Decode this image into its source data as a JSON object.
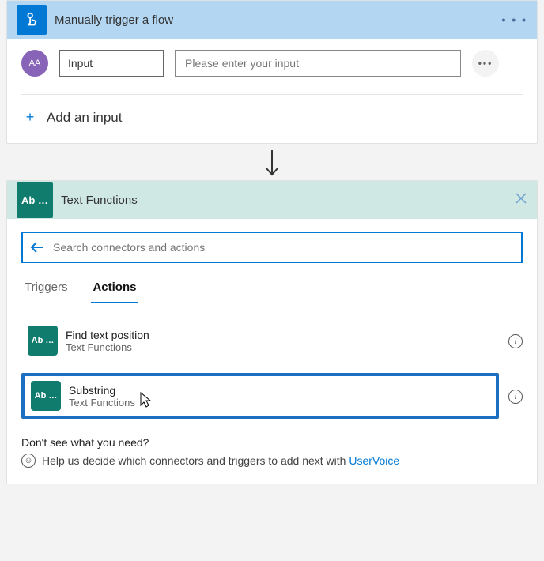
{
  "trigger": {
    "title": "Manually trigger a flow",
    "icon_name": "tap-icon",
    "more_label": "…",
    "input_row": {
      "badge": "AA",
      "name_value": "Input",
      "value_placeholder": "Please enter your input",
      "row_more": "…"
    },
    "add_input_label": "Add an input"
  },
  "action_picker": {
    "title": "Text Functions",
    "icon_text": "Ab …",
    "close_label": "×",
    "search_placeholder": "Search connectors and actions",
    "tabs": [
      {
        "label": "Triggers",
        "active": false
      },
      {
        "label": "Actions",
        "active": true
      }
    ],
    "actions": [
      {
        "icon_text": "Ab …",
        "name": "Find text position",
        "sub": "Text Functions",
        "selected": false
      },
      {
        "icon_text": "Ab …",
        "name": "Substring",
        "sub": "Text Functions",
        "selected": true
      }
    ],
    "uv_title": "Don't see what you need?",
    "uv_text": "Help us decide which connectors and triggers to add next with ",
    "uv_link": "UserVoice"
  }
}
